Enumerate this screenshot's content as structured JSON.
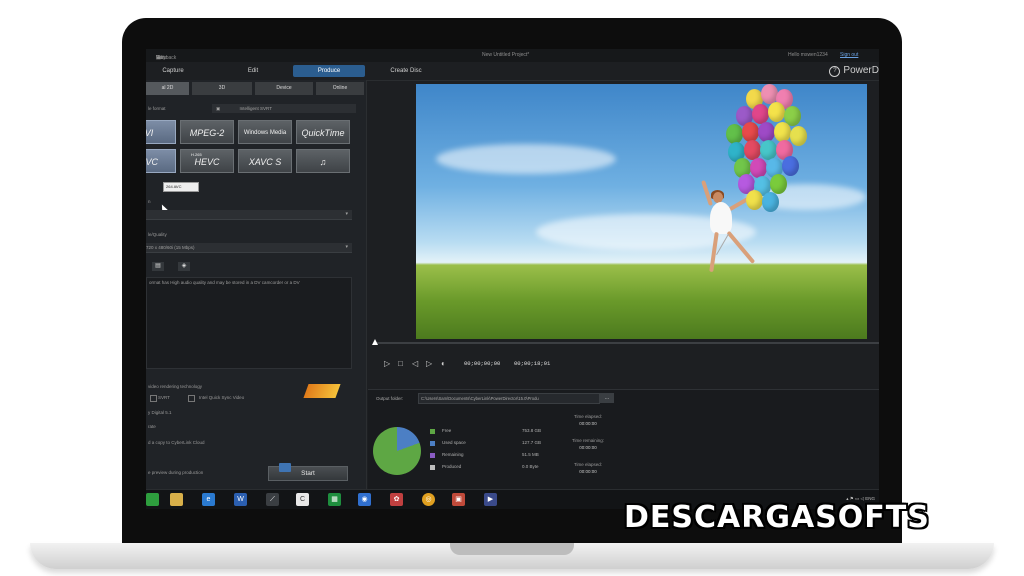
{
  "titlebar": {
    "menus": [
      "Edit",
      "View",
      "Playback"
    ],
    "project_title": "New Untitled Project*",
    "user_greeting": "Hello mswen1234",
    "sign_out": "Sign out"
  },
  "modes": {
    "capture": "Capture",
    "edit": "Edit",
    "produce": "Produce",
    "create_disc": "Create Disc",
    "brand": "PowerD"
  },
  "subtabs": [
    "al 2D",
    "3D",
    "Device",
    "Online"
  ],
  "left": {
    "format_label": "le format",
    "intelligent_label": "Intelligent SVRT",
    "formats": [
      "VI",
      "MPEG-2",
      "Windows Media",
      "QuickTime",
      "AVC",
      "HEVC",
      "XAVC S",
      "♫"
    ],
    "hevc_prefix": "H.265",
    "tooltip": "264 AVC",
    "region_label": "n",
    "quality_label": "le/Quality",
    "quality_value": "720 x 480/60i (15 Mbps)",
    "description": "ormat has High audio quality and may be stored in a DV camcorder or a DV",
    "accel_label": "video rendering technology",
    "svrt_option": "SVRT",
    "quicksync_option": "Intel Quick Sync Video",
    "dolby_label": "y Digital 5.1",
    "auto_label": "rate",
    "cloud_label": "d a copy to CyberLink Cloud",
    "preview_label": "e preview during production",
    "start_button": "Start"
  },
  "player": {
    "timecode_start": "00;00;00;00",
    "timecode_end": "00;00;18;01"
  },
  "output": {
    "folder_label": "Output folder:",
    "folder_path": "C:\\Users\\Sam\\Documents\\CyberLink\\PowerDirector\\15.0\\Produ",
    "browse_label": "...",
    "legend": [
      {
        "name": "Free",
        "value": "753.8 GB",
        "color": "#5ea744"
      },
      {
        "name": "Used space",
        "value": "127.7 GB",
        "color": "#4c7fc4"
      },
      {
        "name": "Remaining",
        "value": "51.5 MB",
        "color": "#8a5cc4"
      },
      {
        "name": "Produced",
        "value": "0.0 Byte",
        "color": "#bdbdbd"
      }
    ],
    "time_elapsed_label": "Time elapsed:",
    "time_elapsed": "00:00:00",
    "time_remaining_label": "Time remaining:",
    "time_remaining": "00:00:00",
    "time_stopped_label": "Time elapsed:",
    "time_stopped": "00:00:00"
  },
  "taskbar": {
    "tray_text": "ENG"
  },
  "watermark": "DESCARGASOFTS"
}
